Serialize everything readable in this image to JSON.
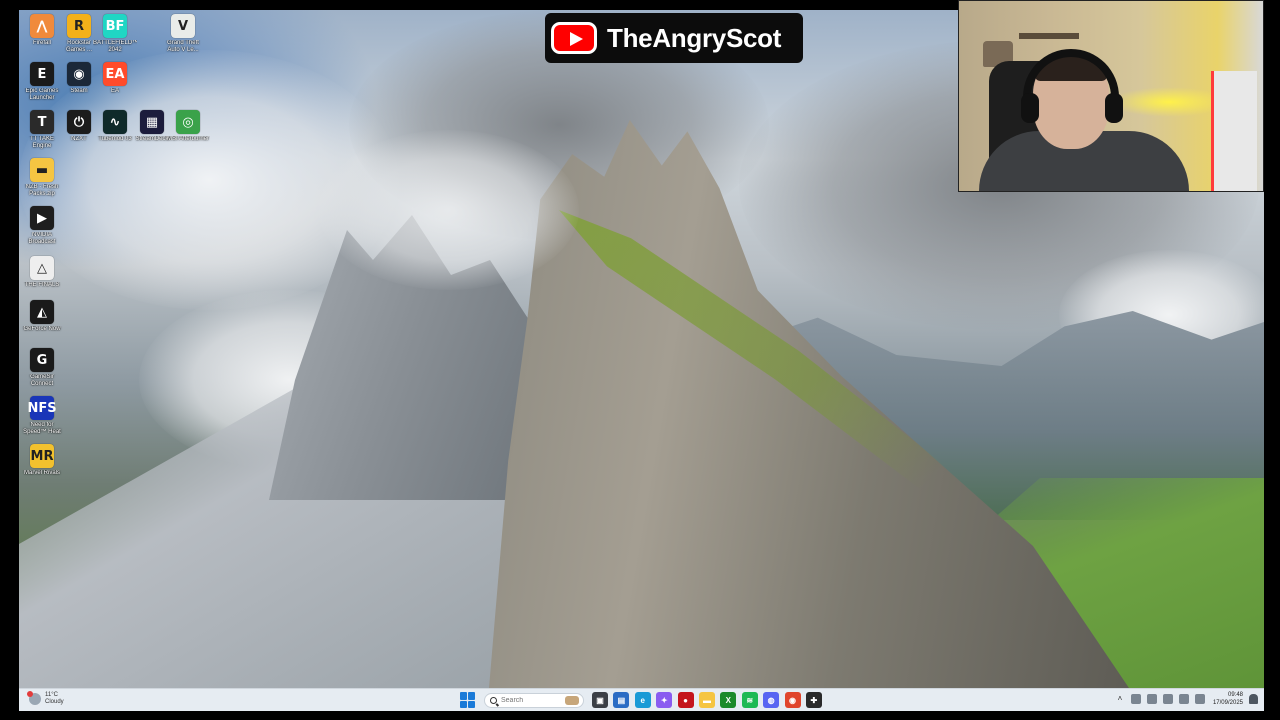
{
  "channel": {
    "name": "TheAngryScot",
    "logo_icon": "youtube-play-icon"
  },
  "desktop": {
    "icons": [
      {
        "label": "Firefall",
        "icon": "firefall-icon",
        "color": "#f08a3c",
        "glyph": "⋀"
      },
      {
        "label": "Rockstar Games ...",
        "icon": "rockstar-icon",
        "color": "#f3b11a",
        "glyph": "R"
      },
      {
        "label": "BATTLEFIELD™ 2042",
        "icon": "battlefield-icon",
        "color": "#1fd6c4",
        "glyph": "BF"
      },
      {
        "label": "Grand Theft Auto V Le...",
        "icon": "gta-icon",
        "color": "#e9ece9",
        "glyph": "V"
      },
      {
        "label": "Epic Games Launcher",
        "icon": "epic-games-icon",
        "color": "#1a1a1a",
        "glyph": "E"
      },
      {
        "label": "Steam",
        "icon": "steam-icon",
        "color": "#1b2838",
        "glyph": "◉"
      },
      {
        "label": "EA",
        "icon": "ea-icon",
        "color": "#ff4b2b",
        "glyph": "EA"
      },
      {
        "label": "TT TAKE Engine",
        "icon": "tt-engine-icon",
        "color": "#2a2a2a",
        "glyph": "T"
      },
      {
        "label": "NZXT",
        "icon": "nzxt-icon",
        "color": "#1c1c1c",
        "glyph": "⏻"
      },
      {
        "label": "Tubemod 03",
        "icon": "tubemod-icon",
        "color": "#0f2a2a",
        "glyph": "∿"
      },
      {
        "label": "StreamDeck",
        "icon": "streamdeck-icon",
        "color": "#1c1c3c",
        "glyph": "▦"
      },
      {
        "label": "MSI Afterburner",
        "icon": "msi-afterburner-icon",
        "color": "#3aa24a",
        "glyph": "◎"
      },
      {
        "label": "NZB - Fresh Packs.zip",
        "icon": "folder-icon",
        "color": "#f5c542",
        "glyph": "▬"
      },
      {
        "label": "NVIDIA Broadcast",
        "icon": "nvidia-broadcast-icon",
        "color": "#1e1e1e",
        "glyph": "▶"
      },
      {
        "label": "THE FINALS",
        "icon": "the-finals-icon",
        "color": "#eeeeee",
        "glyph": "△"
      },
      {
        "label": "GeForce Now",
        "icon": "geforce-now-icon",
        "color": "#1a1a1a",
        "glyph": "◭"
      },
      {
        "label": "GameSir Connect",
        "icon": "gamesir-icon",
        "color": "#1a1a1a",
        "glyph": "G"
      },
      {
        "label": "Need for Speed™ Heat",
        "icon": "nfs-heat-icon",
        "color": "#1a36b8",
        "glyph": "NFS"
      },
      {
        "label": "Marvel Rivals",
        "icon": "marvel-rivals-icon",
        "color": "#f2c12e",
        "glyph": "MR"
      }
    ]
  },
  "taskbar": {
    "weather": {
      "temp": "11°C",
      "condition": "Cloudy",
      "icon": "cloud-weather-icon"
    },
    "start_icon": "windows-start-icon",
    "search_placeholder": "Search",
    "apps": [
      {
        "name": "task-view-icon",
        "color": "#3b3f46",
        "glyph": "▣"
      },
      {
        "name": "file-explorer-icon",
        "color": "#2b6cc4",
        "glyph": "▤"
      },
      {
        "name": "edge-browser-icon",
        "color": "#1a9ad6",
        "glyph": "e"
      },
      {
        "name": "copilot-icon",
        "color": "#8a5cf0",
        "glyph": "✦"
      },
      {
        "name": "record-icon",
        "color": "#c4141b",
        "glyph": "●"
      },
      {
        "name": "folder-icon",
        "color": "#f5c542",
        "glyph": "▬"
      },
      {
        "name": "xbox-icon",
        "color": "#1b8a2a",
        "glyph": "X"
      },
      {
        "name": "spotify-icon",
        "color": "#1db954",
        "glyph": "≋"
      },
      {
        "name": "discord-icon",
        "color": "#5865f2",
        "glyph": "◍"
      },
      {
        "name": "app-red-icon",
        "color": "#e0452c",
        "glyph": "◉"
      },
      {
        "name": "game-bar-icon",
        "color": "#2a2a2a",
        "glyph": "✚"
      }
    ],
    "tray": {
      "icons": [
        "show-hidden-icons-chevron",
        "speaker-icon",
        "network-icon",
        "battery-icon",
        "volume-icon",
        "wifi-icon"
      ],
      "time": "09:48",
      "date": "17/09/2025",
      "notification_icon": "notification-bell-icon"
    }
  }
}
